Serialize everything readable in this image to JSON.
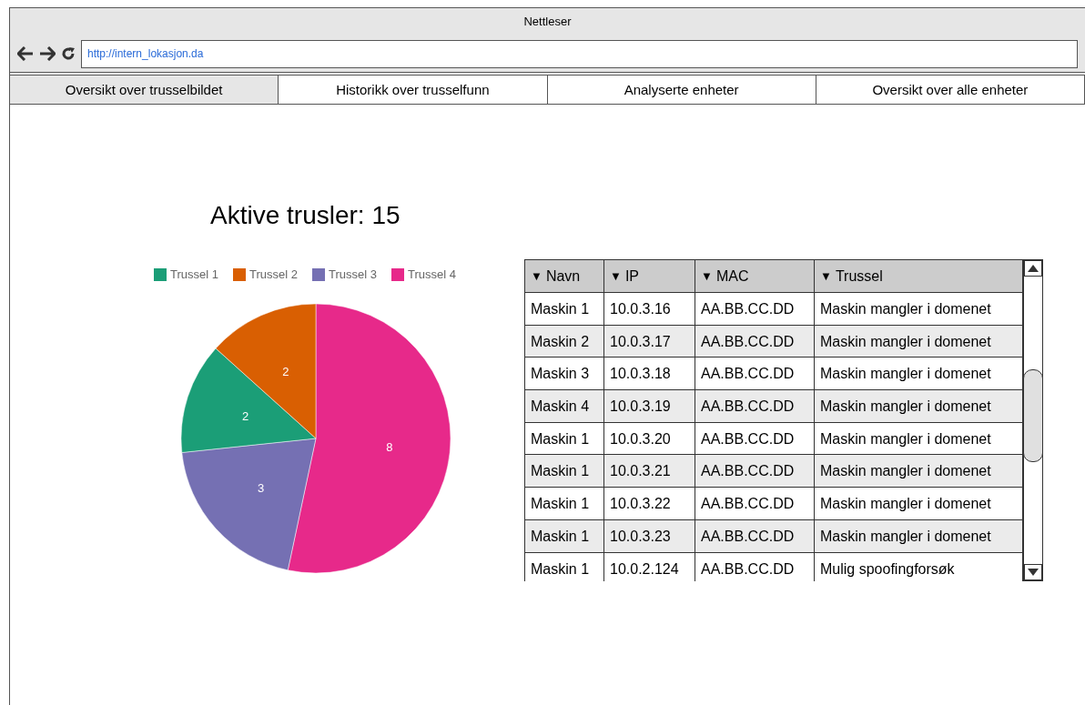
{
  "window": {
    "title": "Nettleser"
  },
  "address_bar": {
    "url": "http://intern_lokasjon.da"
  },
  "tabs": [
    {
      "label": "Oversikt over trusselbildet",
      "selected": true
    },
    {
      "label": "Historikk over trusselfunn",
      "selected": false
    },
    {
      "label": "Analyserte enheter",
      "selected": false
    },
    {
      "label": "Oversikt over alle enheter",
      "selected": false
    }
  ],
  "heading": "Aktive trusler: 15",
  "chart_data": {
    "type": "pie",
    "categories": [
      "Trussel 1",
      "Trussel 2",
      "Trussel 3",
      "Trussel 4"
    ],
    "series": [
      {
        "values": [
          2,
          2,
          3,
          8
        ]
      }
    ],
    "colors": [
      "#1b9e77",
      "#d95f02",
      "#7570b3",
      "#e7298a"
    ],
    "data_labels": true
  },
  "table": {
    "columns": [
      {
        "sort_icon": "▼",
        "label": "Navn"
      },
      {
        "sort_icon": "▼",
        "label": "IP"
      },
      {
        "sort_icon": "▼",
        "label": "MAC"
      },
      {
        "sort_icon": "▼",
        "label": "Trussel"
      }
    ],
    "rows": [
      [
        "Maskin 1",
        "10.0.3.16",
        "AA.BB.CC.DD",
        "Maskin mangler i domenet"
      ],
      [
        "Maskin 2",
        "10.0.3.17",
        "AA.BB.CC.DD",
        "Maskin mangler i domenet"
      ],
      [
        "Maskin 3",
        "10.0.3.18",
        "AA.BB.CC.DD",
        "Maskin mangler i domenet"
      ],
      [
        "Maskin 4",
        "10.0.3.19",
        "AA.BB.CC.DD",
        "Maskin mangler i domenet"
      ],
      [
        "Maskin 1",
        "10.0.3.20",
        "AA.BB.CC.DD",
        "Maskin mangler i domenet"
      ],
      [
        "Maskin 1",
        "10.0.3.21",
        "AA.BB.CC.DD",
        "Maskin mangler i domenet"
      ],
      [
        "Maskin 1",
        "10.0.3.22",
        "AA.BB.CC.DD",
        "Maskin mangler i domenet"
      ],
      [
        "Maskin 1",
        "10.0.3.23",
        "AA.BB.CC.DD",
        "Maskin mangler i domenet"
      ],
      [
        "Maskin 1",
        "10.0.2.124",
        "AA.BB.CC.DD",
        "Mulig spoofingforsøk"
      ]
    ]
  }
}
